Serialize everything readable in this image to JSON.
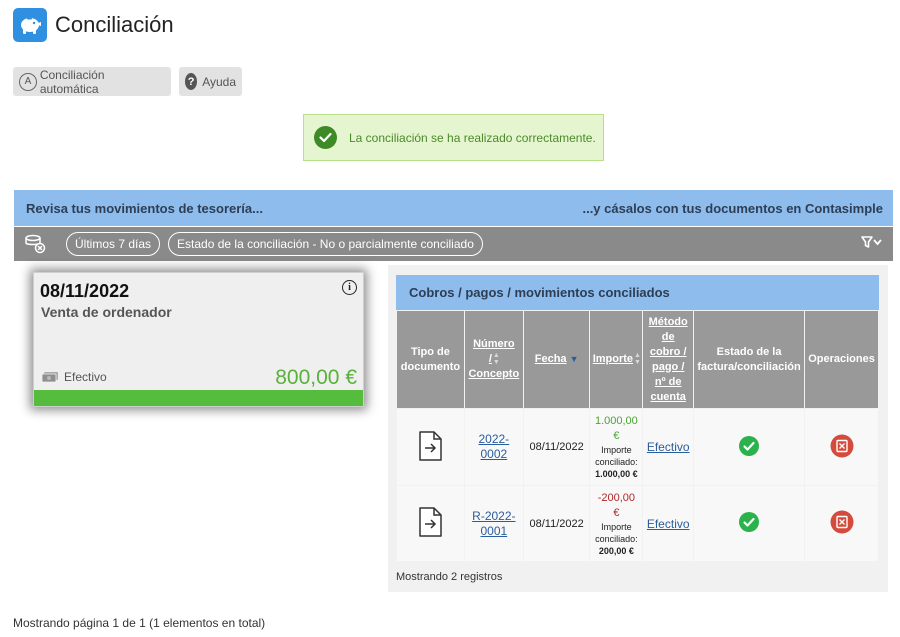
{
  "header": {
    "title": "Conciliación",
    "icon": "piggy-bank-icon"
  },
  "toolbar": {
    "auto_label": "Conciliación automática",
    "auto_icon_letter": "A",
    "help_label": "Ayuda",
    "help_icon_glyph": "?"
  },
  "alert": {
    "message": "La conciliación se ha realizado correctamente."
  },
  "banner": {
    "left": "Revisa tus movimientos de tesorería...",
    "right": "...y cásalos con tus documentos en Contasimple"
  },
  "filters": {
    "period": "Últimos 7 días",
    "status": "Estado de la conciliación - No o parcialmente conciliado"
  },
  "movement": {
    "date": "08/11/2022",
    "description": "Venta de ordenador",
    "method": "Efectivo",
    "amount": "800,00 €",
    "info_glyph": "i"
  },
  "panel": {
    "title": "Cobros / pagos / movimientos conciliados",
    "columns": {
      "tipo": [
        "Tipo de",
        "documento"
      ],
      "numero": [
        "Número",
        "/",
        "Concepto"
      ],
      "fecha": "Fecha",
      "importe": "Importe",
      "metodo": [
        "Método",
        "de",
        "cobro /",
        "pago /",
        "nº de",
        "cuenta"
      ],
      "estado": [
        "Estado de la",
        "factura/conciliación"
      ],
      "operaciones": "Operaciones"
    },
    "rows": [
      {
        "numero": [
          "2022-",
          "0002"
        ],
        "fecha": "08/11/2022",
        "importe": [
          "1.000,00",
          "€"
        ],
        "importe_label": [
          "Importe",
          "conciliado:"
        ],
        "importe_conciliado": "1.000,00 €",
        "metodo": "Efectivo"
      },
      {
        "numero": [
          "R-2022-",
          "0001"
        ],
        "fecha": "08/11/2022",
        "importe": [
          "-200,00",
          "€"
        ],
        "importe_label": [
          "Importe",
          "conciliado:"
        ],
        "importe_conciliado": "200,00 €",
        "metodo": "Efectivo"
      }
    ],
    "footer": "Mostrando 2 registros"
  },
  "footer": "Mostrando página 1 de 1 (1 elementos en total)",
  "colors": {
    "accent_blue": "#8ebcec",
    "filter_gray": "#8a8a8a",
    "success_green": "#56bc3e",
    "danger_red": "#d24b3d",
    "link_blue": "#2a5d9c"
  }
}
